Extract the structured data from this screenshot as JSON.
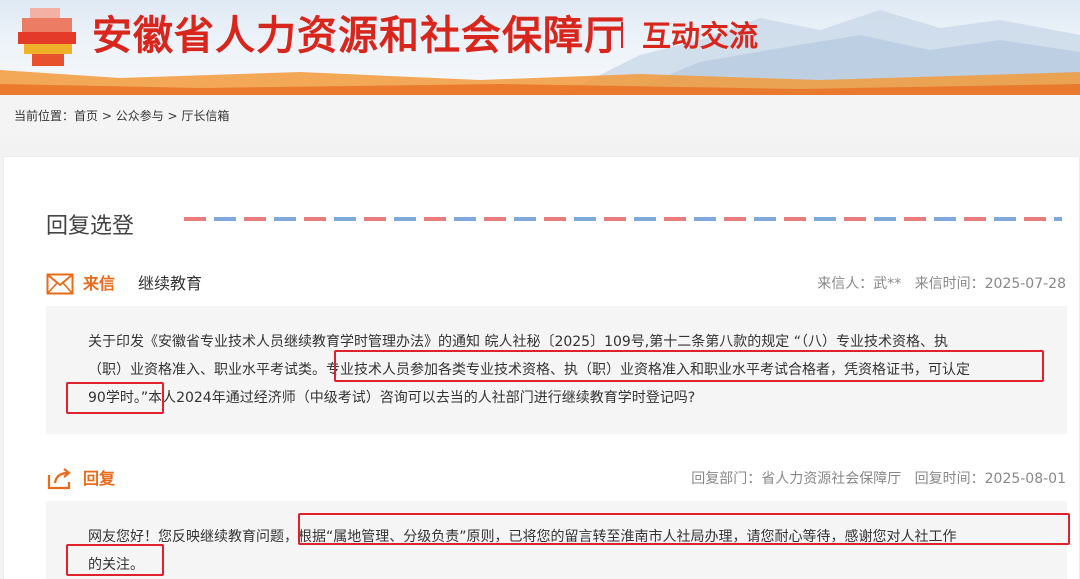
{
  "header": {
    "site_title": "安徽省人力资源和社会保障厅",
    "sub_title": "互动交流"
  },
  "breadcrumb": {
    "prefix": "当前位置：",
    "items": [
      "首页",
      "公众参与",
      "厅长信箱"
    ],
    "separator": " > "
  },
  "section": {
    "title": "回复选登"
  },
  "letter": {
    "tag": "来信",
    "topic": "继续教育",
    "sender_label": "来信人：",
    "sender": "武**",
    "time_label": "来信时间：",
    "time": "2025-07-28",
    "line1": "关于印发《安徽省专业技术人员继续教育学时管理办法》的通知 皖人社秘〔2025〕109号,第十二条第八款的规定 “（八）专业技术资格、执",
    "line2a": "（职）业资格准入、职业水平考试类。",
    "line2b": "专业技术人员参加各类专业技术资格、执（职）业资格准入和职业水平考试合格者，凭资格证书，可认定",
    "line3a": "90学时。”",
    "line3b": "本人2024年通过经济师（中级考试）咨询可以去当的人社部门进行继续教育学时登记吗?"
  },
  "reply": {
    "tag": "回复",
    "dept_label": "回复部门：",
    "dept": "省人力资源社会保障厅",
    "time_label": "回复时间：",
    "time": "2025-08-01",
    "line1a": "网友您好！您反映继续教育问题，",
    "line1b": "根据“属地管理、分级负责”原则，已将您的留言转至淮南市人社局办理，请您耐心等待，感谢您对人社工作",
    "line2": "的关注。"
  },
  "colors": {
    "brand_red": "#d8261c",
    "accent_orange": "#e86b1b",
    "highlight_red": "#e0202a"
  },
  "icons": {
    "letter": "envelope-icon",
    "reply": "reply-arrow-icon"
  }
}
